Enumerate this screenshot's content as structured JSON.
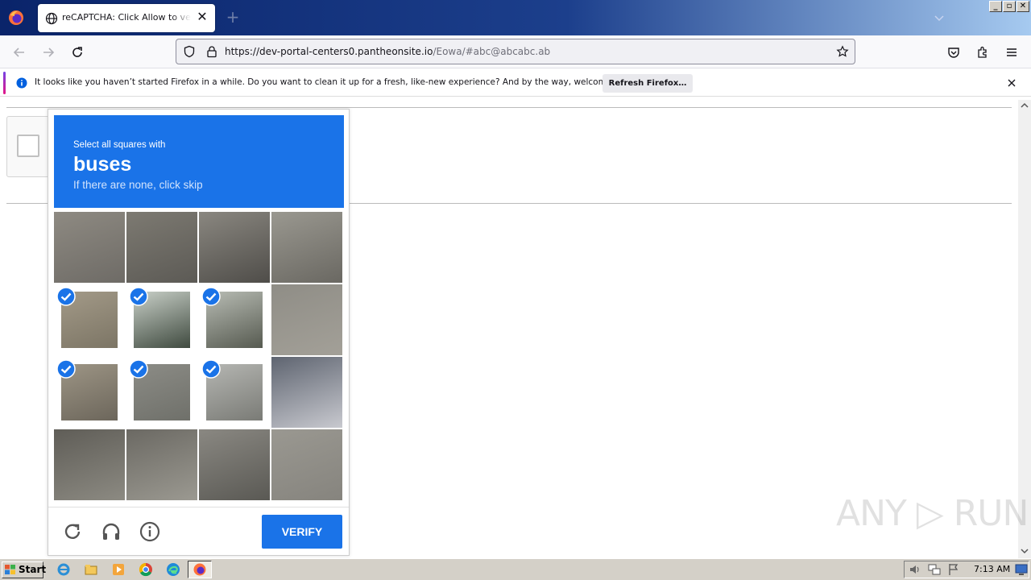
{
  "browser": {
    "tab_title": "reCAPTCHA: Click Allow to verify that you are not a robot",
    "tab_close": "✕",
    "new_tab": "+",
    "url_main": "https://dev-portal-centers0.pantheonsite.io",
    "url_rest": "/Eowa/#abc@abcabc.ab"
  },
  "window_controls": {
    "minimize": "_",
    "restore": "▫",
    "close": "✕"
  },
  "notification": {
    "text": "It looks like you haven’t started Firefox in a while. Do you want to clean it up for a fresh, like-new experience? And by the way, welcome back!",
    "button": "Refresh Firefox…"
  },
  "captcha": {
    "instruction": "Select all squares with",
    "target": "buses",
    "hint": "If there are none, click skip",
    "verify_label": "VERIFY",
    "accent": "#1a73e8",
    "tiles": [
      {
        "selected": false,
        "tone": [
          "#8e8a82",
          "#6e6b66"
        ]
      },
      {
        "selected": false,
        "tone": [
          "#7d7a72",
          "#5c5a55"
        ]
      },
      {
        "selected": false,
        "tone": [
          "#8a8780",
          "#4f4d49"
        ]
      },
      {
        "selected": false,
        "tone": [
          "#9a9890",
          "#6a6862"
        ]
      },
      {
        "selected": true,
        "tone": [
          "#a39a88",
          "#7c7565"
        ]
      },
      {
        "selected": true,
        "tone": [
          "#c9d0c8",
          "#3f4a3f"
        ]
      },
      {
        "selected": true,
        "tone": [
          "#b8bcb4",
          "#565a50"
        ]
      },
      {
        "selected": false,
        "tone": [
          "#8f8d86",
          "#a3a098"
        ]
      },
      {
        "selected": true,
        "tone": [
          "#9d9585",
          "#6c665b"
        ]
      },
      {
        "selected": true,
        "tone": [
          "#8c8c86",
          "#6f706a"
        ]
      },
      {
        "selected": true,
        "tone": [
          "#b5b6b2",
          "#7a7b76"
        ]
      },
      {
        "selected": false,
        "tone": [
          "#5e6470",
          "#c8c9cf"
        ]
      },
      {
        "selected": false,
        "tone": [
          "#5f5d57",
          "#8c8a82"
        ]
      },
      {
        "selected": false,
        "tone": [
          "#6b6963",
          "#9b9991"
        ]
      },
      {
        "selected": false,
        "tone": [
          "#8a8882",
          "#5a5954"
        ]
      },
      {
        "selected": false,
        "tone": [
          "#9a9891",
          "#86847e"
        ]
      }
    ]
  },
  "watermark": "ANY ▷ RUN",
  "taskbar": {
    "start_label": "Start",
    "clock": "7:13 AM",
    "apps": [
      "ie-icon",
      "explorer-icon",
      "media-player-icon",
      "chrome-icon",
      "edge-icon",
      "firefox-icon"
    ]
  }
}
